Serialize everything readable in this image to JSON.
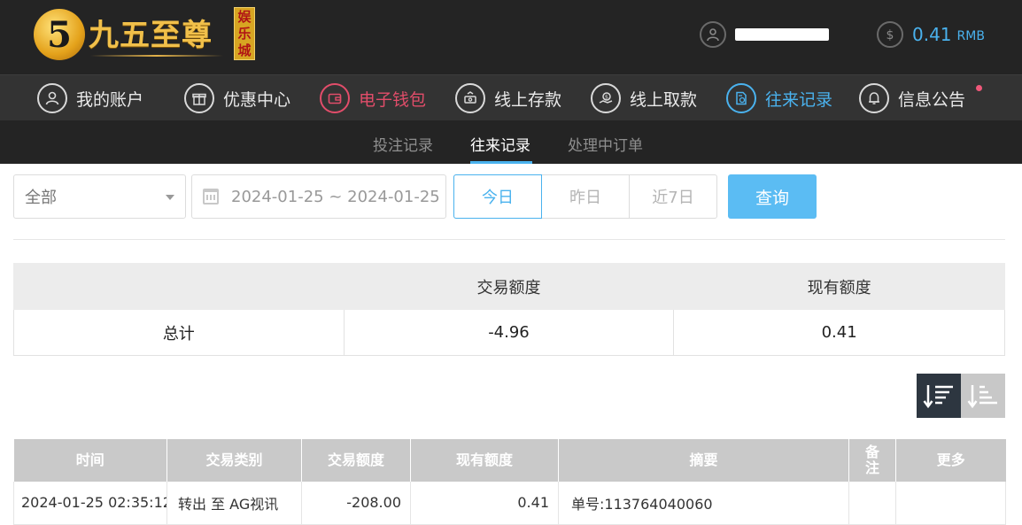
{
  "header": {
    "logo": {
      "badge": "5",
      "name": "九五至尊",
      "tag": "娱乐城"
    },
    "balance": {
      "value": "0.41",
      "unit": "RMB"
    }
  },
  "nav": {
    "items": [
      {
        "label": "我的账户",
        "icon": "user-circle-icon"
      },
      {
        "label": "优惠中心",
        "icon": "gift-icon"
      },
      {
        "label": "电子钱包",
        "icon": "wallet-icon"
      },
      {
        "label": "线上存款",
        "icon": "deposit-icon"
      },
      {
        "label": "线上取款",
        "icon": "withdraw-icon"
      },
      {
        "label": "往来记录",
        "icon": "record-icon"
      },
      {
        "label": "信息公告",
        "icon": "bell-icon"
      }
    ],
    "active_index": 5
  },
  "subnav": {
    "tabs": [
      {
        "label": "投注记录"
      },
      {
        "label": "往来记录"
      },
      {
        "label": "处理中订单"
      }
    ],
    "active_index": 1
  },
  "filter": {
    "type_selected": "全部",
    "date_range": "2024-01-25 ~ 2024-01-25",
    "quick_ranges": [
      "今日",
      "昨日",
      "近7日"
    ],
    "query_label": "查询"
  },
  "summary": {
    "headers": [
      "",
      "交易额度",
      "现有额度"
    ],
    "row": {
      "label": "总计",
      "amount": "-4.96",
      "balance": "0.41"
    }
  },
  "records": {
    "headers": [
      "时间",
      "交易类别",
      "交易额度",
      "现有额度",
      "摘要",
      "备注",
      "更多"
    ],
    "rows": [
      {
        "time": "2024-01-25 02:35:12",
        "type": "转出 至 AG视讯",
        "amount": "-208.00",
        "balance": "0.41",
        "summary": "单号:113764040060",
        "note": "",
        "more": ""
      }
    ]
  },
  "colors": {
    "accent": "#4ab2ee",
    "wallet": "#e24d6a",
    "header_bg": "#242424",
    "nav_bg": "#333333"
  }
}
